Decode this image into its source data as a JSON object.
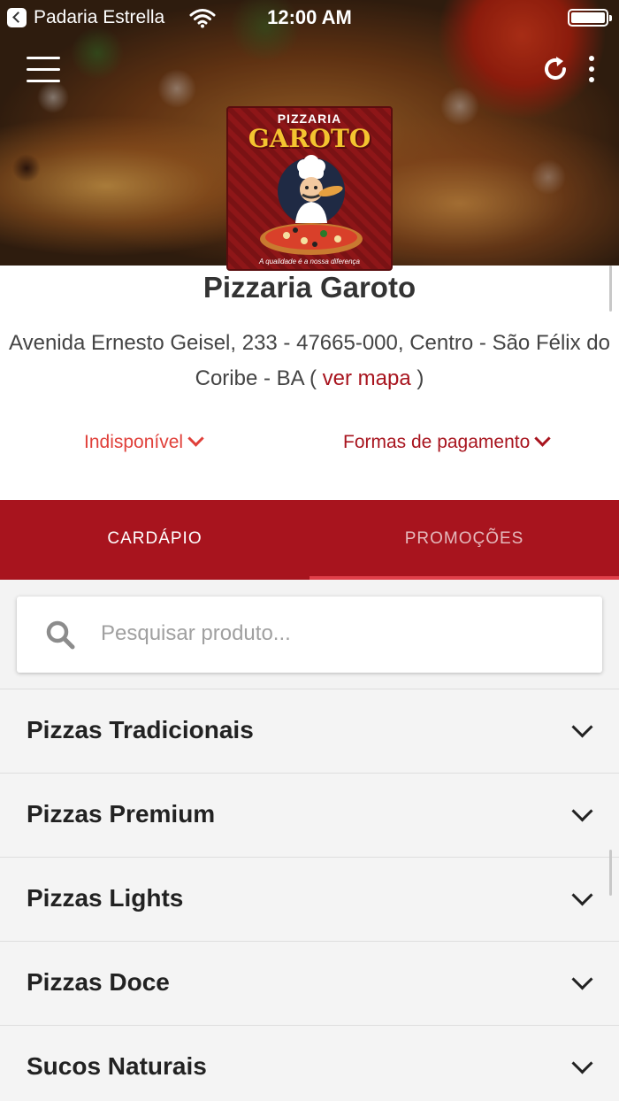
{
  "status_bar": {
    "back_app": "Padaria Estrella",
    "time": "12:00 AM"
  },
  "header": {
    "menu_icon": "hamburger-icon",
    "refresh_icon": "refresh-icon",
    "more_icon": "more-vertical-icon"
  },
  "logo": {
    "top_text": "PIZZARIA",
    "name": "GAROTO",
    "slogan": "A qualidade é a nossa diferença"
  },
  "store": {
    "name": "Pizzaria Garoto",
    "address": "Avenida Ernesto Geisel, 233 - 47665-000, Centro - São Félix do Coribe - BA (",
    "map_link": "ver mapa",
    "address_end": ")",
    "status": "Indisponível",
    "payment": "Formas de pagamento"
  },
  "tabs": [
    {
      "label": "CARDÁPIO"
    },
    {
      "label": "PROMOÇÕES"
    }
  ],
  "search": {
    "placeholder": "Pesquisar produto...",
    "value": ""
  },
  "categories": [
    {
      "label": "Pizzas Tradicionais"
    },
    {
      "label": "Pizzas Premium"
    },
    {
      "label": "Pizzas Lights"
    },
    {
      "label": "Pizzas Doce"
    },
    {
      "label": "Sucos Naturais"
    }
  ],
  "colors": {
    "brand": "#a8141e",
    "status_red": "#e0403a"
  }
}
